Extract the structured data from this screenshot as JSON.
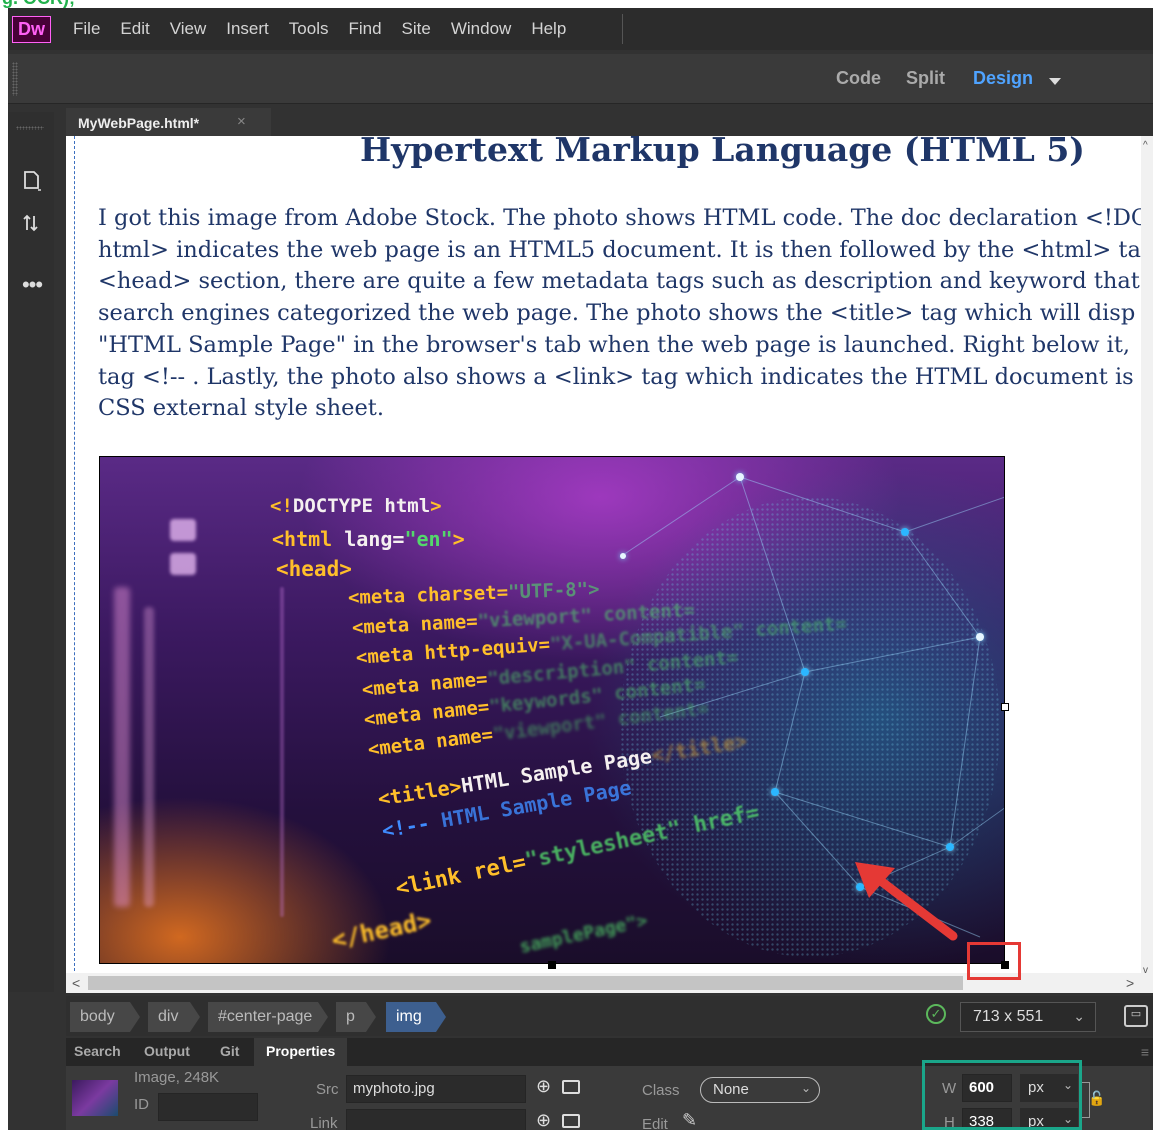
{
  "top_strip_text": "g. OCR);",
  "app": {
    "logo": "Dw"
  },
  "menu": [
    "File",
    "Edit",
    "View",
    "Insert",
    "Tools",
    "Find",
    "Site",
    "Window",
    "Help"
  ],
  "views": {
    "code": "Code",
    "split": "Split",
    "design": "Design",
    "active": "Design"
  },
  "left_toolbar": {
    "icons": [
      "document-icon",
      "sort-icon",
      "more-icon"
    ],
    "more_label": "•••"
  },
  "doc_tab": {
    "title": "MyWebPage.html*",
    "close": "×"
  },
  "page": {
    "heading": "Hypertext Markup Language (HTML 5)",
    "paragraph_lines": [
      "I got this image from Adobe Stock. The photo shows HTML code. The doc declaration <!DO",
      "html> indicates the web page is an HTML5 document. It is then followed by the <html> ta",
      "<head> section, there are quite a few metadata tags such as description and keyword that",
      "search engines categorized the web page. The photo shows the <title> tag which will disp",
      "\"HTML Sample Page\" in the browser's tab when the web page is launched. Right below it,",
      "tag <!-- . Lastly, the photo also shows a <link> tag which indicates the HTML document is",
      "CSS external style sheet."
    ]
  },
  "photo_code": {
    "doctype": [
      "<!",
      "DOCTYPE html",
      ">"
    ],
    "html": [
      "<html",
      " lang=",
      "\"en\"",
      ">"
    ],
    "head": "<head>",
    "meta1": [
      "<meta charset=",
      "\"UTF-8\">"
    ],
    "meta2": [
      "<meta name=",
      "\"viewport\" content="
    ],
    "meta3": [
      "<meta http-equiv=",
      "\"X-UA-Compatible\" content="
    ],
    "meta4": [
      "<meta name=",
      "\"description\" content="
    ],
    "meta5": [
      "<meta name=",
      "\"keywords\" content="
    ],
    "meta6": [
      "<meta name=",
      "\"viewport\" content="
    ],
    "title": [
      "<title>",
      "HTML Sample Page",
      "</title>"
    ],
    "comment": [
      "<!-- ",
      "HTML Sample Page"
    ],
    "link": [
      "<link rel=",
      "\"stylesheet\" href="
    ],
    "head_close": "</head>",
    "sample": "samplePage\">"
  },
  "scrollbar": {
    "left_arrow": "<",
    "right_arrow": ">",
    "up_arrow": "^",
    "down_arrow": "v"
  },
  "tag_selector": {
    "tags": [
      "body",
      "div",
      "#center-page",
      "p",
      "img"
    ],
    "active": "img"
  },
  "status": {
    "ok_symbol": "✓",
    "window_size": "713 x 551",
    "size_chevron": "⌄"
  },
  "panel_tabs": [
    "Search",
    "Output",
    "Git",
    "Properties"
  ],
  "panel_tab_active": "Properties",
  "properties": {
    "image_info": "Image, 248K",
    "id_label": "ID",
    "id_value": "",
    "src_label": "Src",
    "src_value": "myphoto.jpg",
    "link_label": "Link",
    "link_value": "",
    "class_label": "Class",
    "class_value": "None",
    "edit_label": "Edit",
    "w_label": "W",
    "w_value": "600",
    "w_unit": "px",
    "h_label": "H",
    "h_value": "338",
    "h_unit": "px",
    "lock_symbol": "🔓"
  },
  "colors": {
    "accent_blue": "#4fa3ff",
    "annotation_red": "#e53935",
    "annotation_teal": "#1aa68a",
    "heading_navy": "#1f3668",
    "logo_pink": "#ff61f6"
  }
}
